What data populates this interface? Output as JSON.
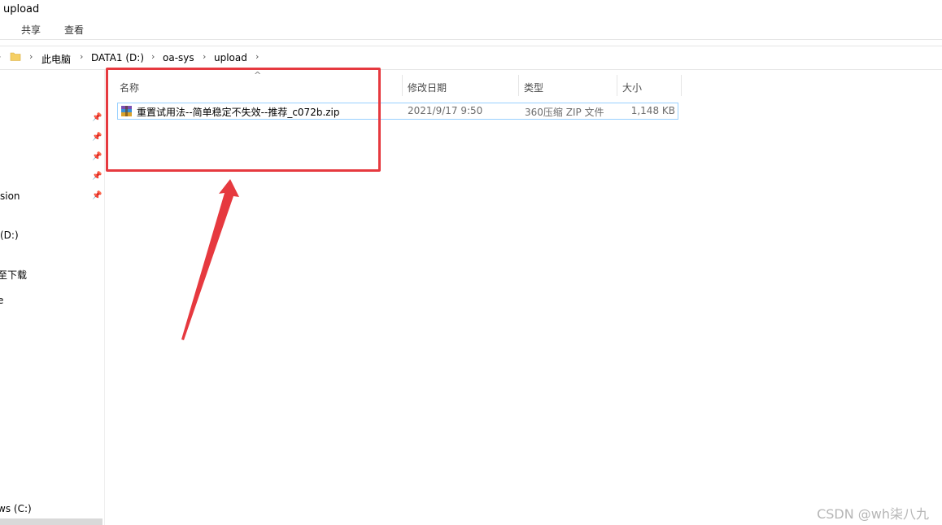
{
  "window": {
    "title": "upload"
  },
  "ribbon": {
    "tabs": [
      "共享",
      "查看"
    ]
  },
  "breadcrumb": [
    "此电脑",
    "DATA1 (D:)",
    "oa-sys",
    "upload"
  ],
  "nav_pane": {
    "items": [
      {
        "label": "sion"
      },
      {
        "label": "(D:)"
      },
      {
        "label": "至下载"
      },
      {
        "label": "e"
      },
      {
        "label": "ws (C:)"
      }
    ]
  },
  "columns": {
    "name": "名称",
    "modified": "修改日期",
    "type": "类型",
    "size": "大小"
  },
  "files": [
    {
      "name": "重置试用法--简单稳定不失效--推荐_c072b.zip",
      "modified": "2021/9/17 9:50",
      "type": "360压缩 ZIP 文件",
      "size": "1,148 KB"
    }
  ],
  "watermark": "CSDN @wh柒八九",
  "colors": {
    "highlight": "#e6393f",
    "selection_border": "#99d1ff"
  }
}
